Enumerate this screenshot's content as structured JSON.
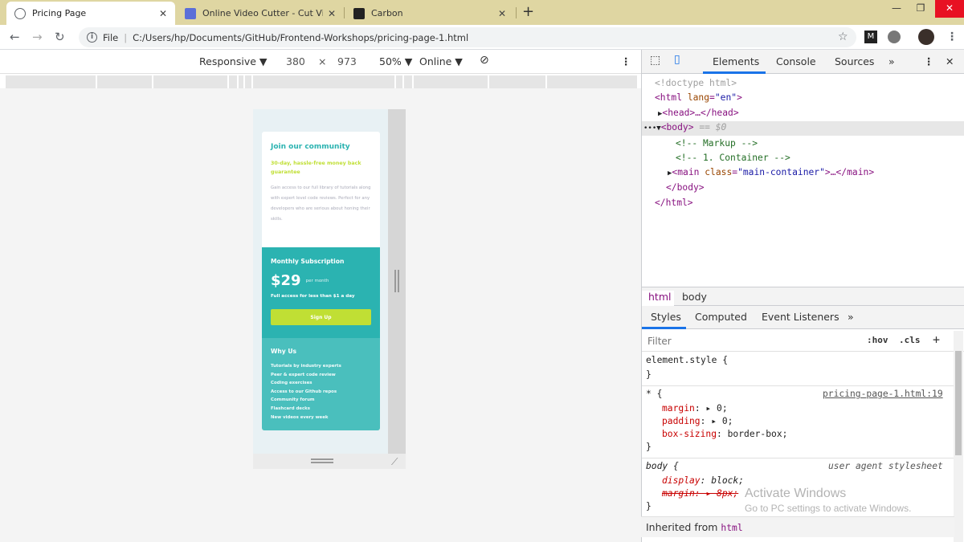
{
  "browser": {
    "tabs": [
      {
        "title": "Pricing Page",
        "active": true
      },
      {
        "title": "Online Video Cutter - Cut Video",
        "active": false
      },
      {
        "title": "Carbon",
        "active": false
      }
    ],
    "new_tab": "+",
    "address": {
      "scheme": "File",
      "url": "C:/Users/hp/Documents/GitHub/Frontend-Workshops/pricing-page-1.html"
    }
  },
  "device_toolbar": {
    "mode": "Responsive ▼",
    "width": "380",
    "times": "×",
    "height": "973",
    "zoom": "50% ▼",
    "network": "Online ▼"
  },
  "card": {
    "title": "Join our community",
    "subtitle": "30-day, hassle-free money back guarantee",
    "description": "Gain access to our full library of tutorials along with expert level code reviews. Perfect for any developers who are serious about honing their skills.",
    "sub_title": "Monthly Subscription",
    "price": "$29",
    "per": "per month",
    "access": "Full access for less than $1 a day",
    "signup": "Sign Up",
    "why_title": "Why Us",
    "why_items": [
      "Tutorials by industry experts",
      "Peer & expert code review",
      "Coding exercises",
      "Access to our Github repos",
      "Community forum",
      "Flashcard decks",
      "New videos every week"
    ]
  },
  "devtools": {
    "tabs": [
      "Elements",
      "Console",
      "Sources",
      "»"
    ],
    "code": {
      "doctype": "<!doctype html>",
      "html_open": "<html",
      "lang_attr": "lang",
      "lang_val": "\"en\"",
      "head": "<head>…</head>",
      "body_open": "<body>",
      "body_eq": "== $0",
      "comment1": "<!-- Markup -->",
      "comment2": "<!-- 1. Container -->",
      "main_tag": "<main",
      "class_attr": "class",
      "class_val": "\"main-container\"",
      "main_rest": ">…</main>",
      "body_close": "</body>",
      "html_close": "</html>"
    },
    "breadcrumbs": [
      "html",
      "body"
    ],
    "subtabs": [
      "Styles",
      "Computed",
      "Event Listeners",
      "»"
    ],
    "filter_placeholder": "Filter",
    "hov": ":hov",
    "cls": ".cls",
    "plus": "+",
    "rules": {
      "element_style": "element.style {",
      "close": "}",
      "star_selector": "* {",
      "star_source": "pricing-page-1.html:19",
      "margin_prop": "margin",
      "margin_val": ": ▸ 0;",
      "padding_prop": "padding",
      "padding_val": ": ▸ 0;",
      "boxsizing_prop": "box-sizing",
      "boxsizing_val": ": border-box;",
      "body_selector": "body {",
      "ua_source": "user agent stylesheet",
      "display_prop": "display",
      "display_val": ": block;",
      "margin_struck": "margin: ▸ 8px;"
    },
    "inherited_label": "Inherited from",
    "inherited_tag": "html"
  },
  "watermark": {
    "line1": "Activate Windows",
    "line2": "Go to PC settings to activate Windows."
  },
  "colors": {
    "accent": "#2bb3b1",
    "accent_light": "#4abfbd",
    "lime": "#c0df34",
    "devtools_blue": "#1a73e8"
  }
}
